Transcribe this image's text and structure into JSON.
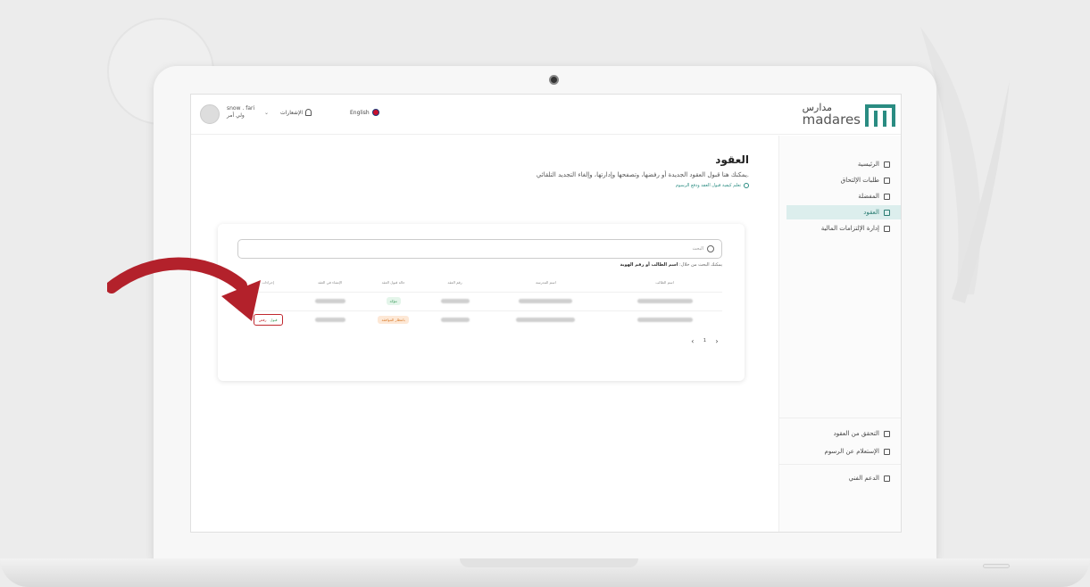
{
  "header": {
    "user_name": "snow . fari",
    "user_role": "ولي أمر",
    "notifications_label": "الإشعارات",
    "language_label": "English"
  },
  "logo": {
    "arabic": "مدارس",
    "english": "madares"
  },
  "sidebar": {
    "items": [
      {
        "label": "الرئيسية",
        "icon": "home-icon"
      },
      {
        "label": "طلبات الإلتحاق",
        "icon": "applications-icon"
      },
      {
        "label": "المفضلة",
        "icon": "favorites-icon"
      },
      {
        "label": "العقود",
        "icon": "contracts-icon",
        "active": true
      },
      {
        "label": "إدارة الإلتزامات المالية",
        "icon": "finance-icon"
      }
    ],
    "bottom_items": [
      {
        "label": "التحقق من العقود",
        "icon": "verify-icon"
      },
      {
        "label": "الإستعلام عن الرسوم",
        "icon": "fees-icon"
      },
      {
        "label": "الدعم الفني",
        "icon": "support-icon"
      }
    ]
  },
  "main": {
    "title": "العقود",
    "subtitle": "يمكنك هنا قبول العقود الجديدة أو رفضها، وتصفحها وإدارتها، وإلغاء التجديد التلقائي.",
    "help_link": "تعلم كيفية قبول العقد ودفع الرسوم"
  },
  "search": {
    "placeholder": "البحث",
    "hint_prefix": "يمكنك البحث من خلال:",
    "hint_fields": "اسم الطالب أو رقم الهوية"
  },
  "table": {
    "headers": [
      "اسم الطالب",
      "اسم المدرسة",
      "رقم العقد",
      "حالة قبول العقد",
      "الإنشاء في العقد",
      "إجراءات"
    ],
    "rows": [
      {
        "status": "مؤكد",
        "status_color": "green",
        "actions": false
      },
      {
        "status": "بانتظار الموافقة",
        "status_color": "orange",
        "actions": true
      }
    ],
    "accept_label": "قبول",
    "reject_label": "رفض"
  },
  "pagination": {
    "current_page": "1"
  },
  "colors": {
    "accent": "#2a8c82",
    "highlight": "#c0282f"
  }
}
